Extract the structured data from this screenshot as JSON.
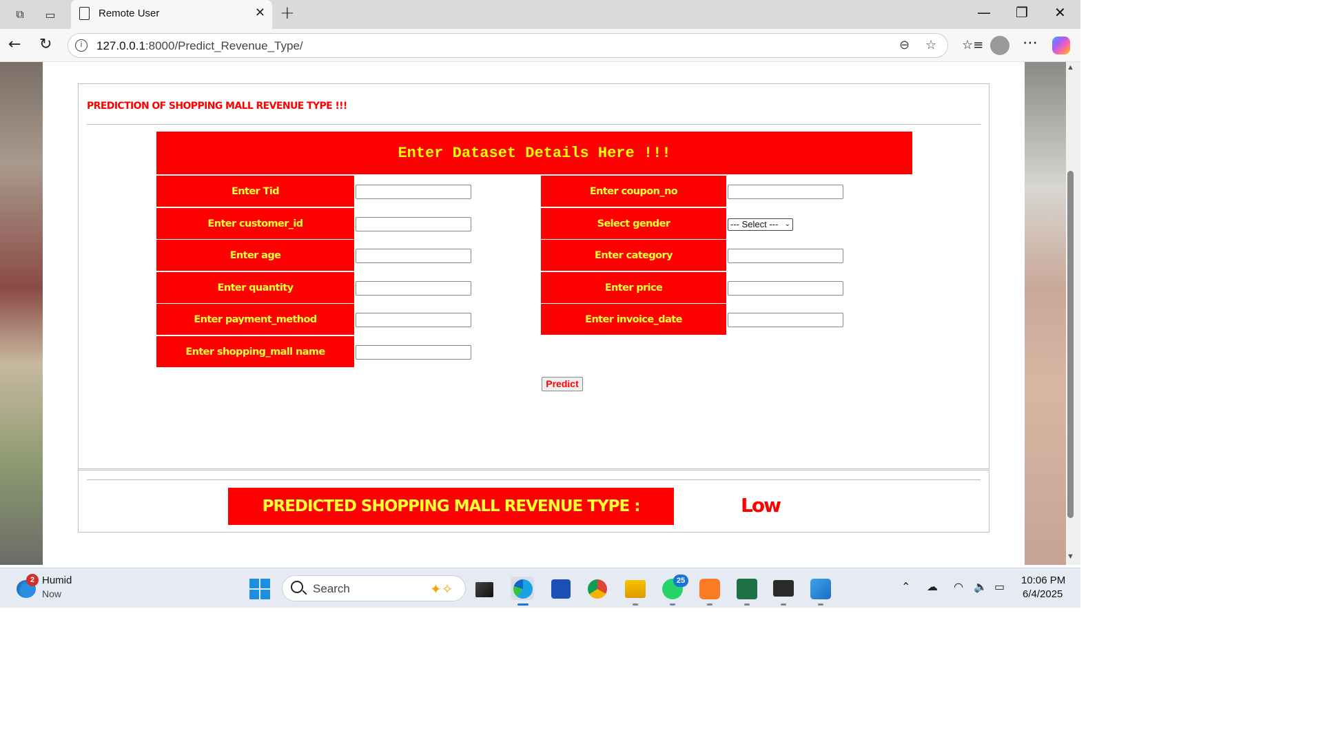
{
  "browser": {
    "tab_title": "Remote User",
    "url_host": "127.0.0.1",
    "url_path": ":8000/Predict_Revenue_Type/"
  },
  "page": {
    "heading": "PREDICTION OF SHOPPING MALL REVENUE TYPE !!!",
    "form_header": "Enter Dataset Details Here !!!",
    "fields_left": [
      {
        "label": "Enter Tid",
        "value": ""
      },
      {
        "label": "Enter customer_id",
        "value": ""
      },
      {
        "label": "Enter age",
        "value": ""
      },
      {
        "label": "Enter quantity",
        "value": ""
      },
      {
        "label": "Enter payment_method",
        "value": ""
      },
      {
        "label": "Enter shopping_mall name",
        "value": ""
      }
    ],
    "fields_right": [
      {
        "label": "Enter coupon_no",
        "value": ""
      },
      {
        "label": "Select gender",
        "value": "--- Select ---"
      },
      {
        "label": "Enter category",
        "value": ""
      },
      {
        "label": "Enter price",
        "value": ""
      },
      {
        "label": "Enter invoice_date",
        "value": ""
      }
    ],
    "predict_button": "Predict",
    "result_label": "PREDICTED SHOPPING MALL REVENUE TYPE :",
    "result_value": "Low"
  },
  "taskbar": {
    "weather_title": "Humid",
    "weather_sub": "Now",
    "weather_badge": "2",
    "search_placeholder": "Search",
    "whatsapp_badge": "25",
    "time": "10:06 PM",
    "date": "6/4/2025"
  },
  "colors": {
    "label_bg": "#ff0000",
    "label_text": "#ffff33"
  }
}
